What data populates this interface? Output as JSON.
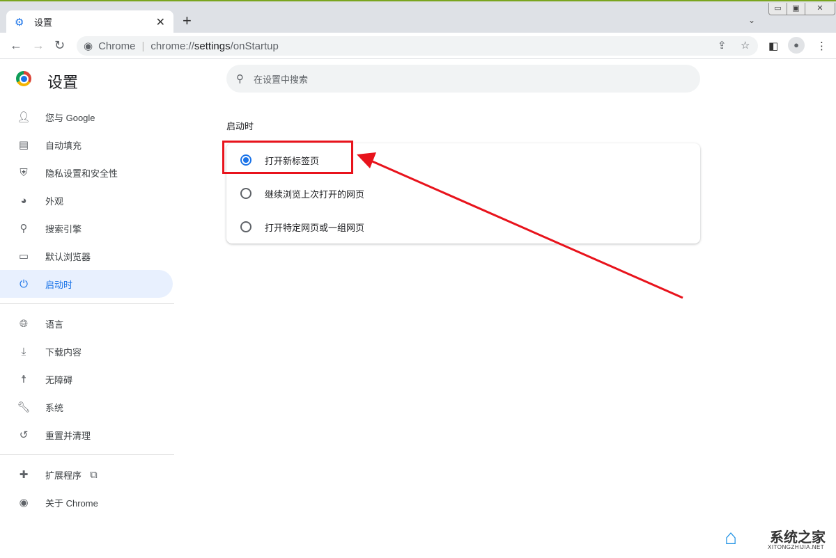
{
  "browser": {
    "tab_title": "设置",
    "site_label": "Chrome",
    "url_prefix": "chrome://",
    "url_path": "settings",
    "url_suffix": "/onStartup"
  },
  "page": {
    "title": "设置",
    "search_placeholder": "在设置中搜索"
  },
  "sidebar": {
    "items": [
      {
        "label": "您与 Google",
        "icon": "person-icon"
      },
      {
        "label": "自动填充",
        "icon": "clipboard-icon"
      },
      {
        "label": "隐私设置和安全性",
        "icon": "shield-icon"
      },
      {
        "label": "外观",
        "icon": "palette-icon"
      },
      {
        "label": "搜索引擎",
        "icon": "search-icon"
      },
      {
        "label": "默认浏览器",
        "icon": "browser-icon"
      },
      {
        "label": "启动时",
        "icon": "power-icon"
      },
      {
        "label": "语言",
        "icon": "globe-icon"
      },
      {
        "label": "下载内容",
        "icon": "download-icon"
      },
      {
        "label": "无障碍",
        "icon": "accessibility-icon"
      },
      {
        "label": "系统",
        "icon": "wrench-icon"
      },
      {
        "label": "重置并清理",
        "icon": "history-icon"
      },
      {
        "label": "扩展程序",
        "icon": "puzzle-icon"
      },
      {
        "label": "关于 Chrome",
        "icon": "chrome-icon"
      }
    ]
  },
  "startup": {
    "heading": "启动时",
    "options": [
      {
        "label": "打开新标签页",
        "selected": true
      },
      {
        "label": "继续浏览上次打开的网页",
        "selected": false
      },
      {
        "label": "打开特定网页或一组网页",
        "selected": false
      }
    ]
  },
  "watermark": {
    "cn": "系统之家",
    "en": "XITONGZHIJIA.NET"
  },
  "colors": {
    "accent": "#1a73e8",
    "annotation": "#e8131c"
  }
}
